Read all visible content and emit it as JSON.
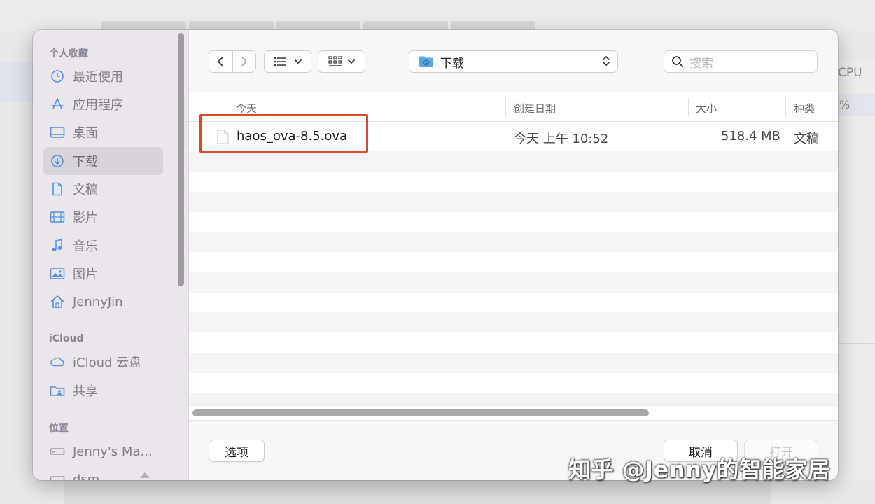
{
  "background_app": {
    "cpu_label": "CPU",
    "percent_label": "%"
  },
  "sidebar": {
    "sections": [
      {
        "title": "个人收藏",
        "items": [
          {
            "label": "最近使用",
            "icon": "clock-icon"
          },
          {
            "label": "应用程序",
            "icon": "applications-icon"
          },
          {
            "label": "桌面",
            "icon": "desktop-icon"
          },
          {
            "label": "下载",
            "icon": "downloads-icon",
            "selected": true
          },
          {
            "label": "文稿",
            "icon": "document-icon"
          },
          {
            "label": "影片",
            "icon": "film-icon"
          },
          {
            "label": "音乐",
            "icon": "music-icon"
          },
          {
            "label": "图片",
            "icon": "photo-icon"
          },
          {
            "label": "JennyJin",
            "icon": "home-icon"
          }
        ]
      },
      {
        "title": "iCloud",
        "items": [
          {
            "label": "iCloud 云盘",
            "icon": "cloud-icon"
          },
          {
            "label": "共享",
            "icon": "shared-folder-icon"
          }
        ]
      },
      {
        "title": "位置",
        "items": [
          {
            "label": "Jenny's Ma...",
            "icon": "laptop-icon"
          },
          {
            "label": "dsm",
            "icon": "drive-icon"
          }
        ]
      }
    ]
  },
  "toolbar": {
    "location_label": "下载",
    "search_placeholder": "搜索"
  },
  "columns": {
    "name": "今天",
    "date": "创建日期",
    "size": "大小",
    "kind": "种类"
  },
  "files": [
    {
      "name": "haos_ova-8.5.ova",
      "date": "今天 上午 10:52",
      "size": "518.4 MB",
      "kind": "文稿"
    }
  ],
  "bottom": {
    "options_label": "选项",
    "cancel_label": "取消",
    "open_label": "打开"
  },
  "watermark": "知乎 @Jenny的智能家居",
  "colors": {
    "highlight_border": "#d9482f",
    "accent": "#4f93e8"
  }
}
